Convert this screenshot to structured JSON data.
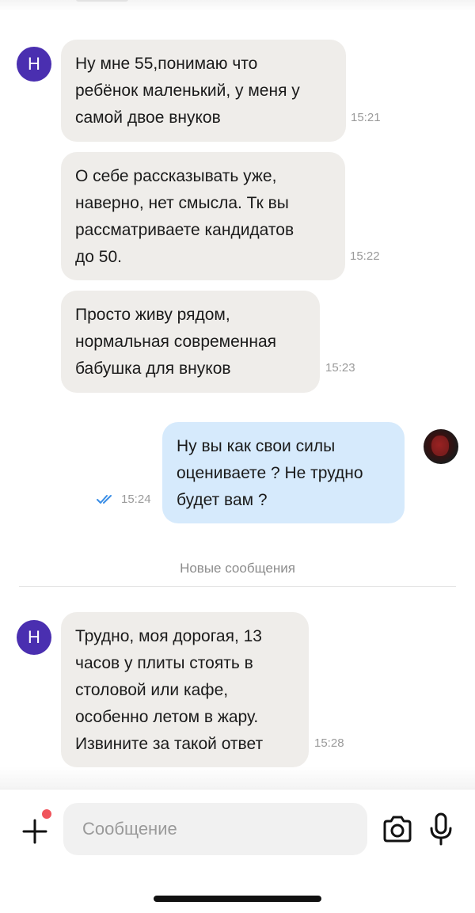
{
  "colors": {
    "incoming_bubble": "#efedea",
    "outgoing_bubble": "#d6eafc",
    "avatar": "#4a2fb0",
    "read_ticks": "#3a8ee6",
    "notification_dot": "#f0545c"
  },
  "messages": [
    {
      "sender": "Н",
      "direction": "incoming",
      "text": "Ну мне 55,понимаю что\nребёнок маленький, у меня у\nсамой двое внуков",
      "time": "15:21"
    },
    {
      "direction": "incoming",
      "text": "О себе рассказывать уже,\nнаверно, нет смысла. Тк вы\nрассматриваете кандидатов\nдо 50.",
      "time": "15:22"
    },
    {
      "direction": "incoming",
      "text": "Просто живу рядом,\nнормальная современная\nбабушка для внуков",
      "time": "15:23"
    },
    {
      "direction": "outgoing",
      "text": "Ну вы как свои силы\nоцениваете ? Не трудно\nбудет вам ?",
      "time": "15:24",
      "status_icon": "double-check-icon"
    },
    {
      "sender": "Н",
      "direction": "incoming",
      "text": "Трудно, моя дорогая, 13\nчасов у плиты стоять в\nстоловой или кафе,\nособенно летом в жару.\nИзвините за  такой ответ",
      "time": "15:28"
    }
  ],
  "divider": {
    "label": "Новые сообщения"
  },
  "composer": {
    "placeholder": "Сообщение",
    "icons": [
      "plus-icon",
      "camera-icon",
      "microphone-icon"
    ]
  }
}
